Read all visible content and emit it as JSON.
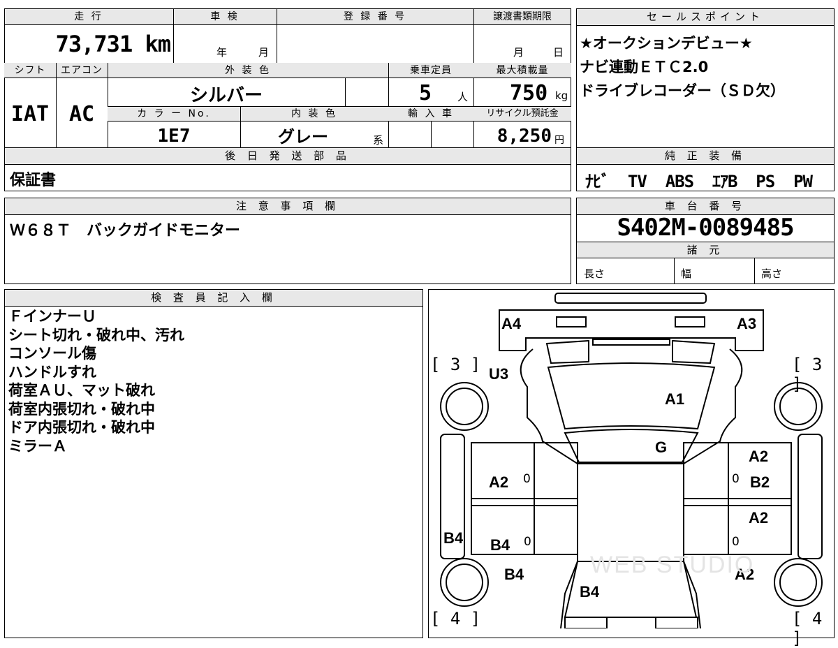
{
  "vehicle": {
    "mileage_label": "走 行",
    "mileage": "73,731 km",
    "inspection_label": "車 検",
    "inspection_year_unit": "年",
    "inspection_month_unit": "月",
    "registration_label": "登 録 番 号",
    "transfer_label": "譲渡書類期限",
    "transfer_month_unit": "月",
    "transfer_day_unit": "日",
    "shift_label": "シフト",
    "shift": "IAT",
    "ac_label": "エアコン",
    "ac": "AC",
    "exterior_color_label": "外 装 色",
    "exterior_color": "シルバー",
    "capacity_label": "乗車定員",
    "capacity": "5",
    "capacity_unit": "人",
    "max_load_label": "最大積載量",
    "max_load": "750",
    "max_load_unit": "kg",
    "color_no_label": "カ ラ ー No.",
    "color_no": "1E7",
    "interior_color_label": "内 装 色",
    "interior_color": "グレー",
    "interior_suffix": "系",
    "import_label": "輸 入 車",
    "recycle_label": "リサイクル預託金",
    "recycle_fee": "8,250",
    "recycle_unit": "円"
  },
  "sales_points": {
    "label": "セールスポイント",
    "lines": [
      "★オークションデビュー★",
      "ナビ連動ＥＴＣ2.0",
      "ドライブレコーダー（ＳＤ欠）"
    ]
  },
  "later_parts": {
    "label": "後 日 発 送 部 品",
    "value": "保証書"
  },
  "genuine_equipment": {
    "label": "純 正 装 備",
    "value": "ﾅﾋﾞ  TV  ABS  ｴｱB  PS  PW"
  },
  "notes": {
    "label": "注 意 事 項 欄",
    "value": "Ｗ６８Ｔ　バックガイドモニター"
  },
  "chassis": {
    "label": "車 台 番 号",
    "value": "S402M-0089485"
  },
  "specs": {
    "label": "諸 元",
    "length_label": "長さ",
    "width_label": "幅",
    "height_label": "高さ"
  },
  "inspector": {
    "label": "検 査 員 記 入 欄",
    "lines": [
      "ＦインナーＵ",
      "シート切れ・破れ中、汚れ",
      "コンソール傷",
      "ハンドルすれ",
      "荷室ＡＵ、マット破れ",
      "荷室内張切れ・破れ中",
      "ドア内張切れ・破れ中",
      "ミラーＡ"
    ]
  },
  "diagram": {
    "marks": {
      "front_left": "A4",
      "front_right": "A3",
      "hood_left": "U3",
      "windshield": "A1",
      "roof": "G",
      "left_front_door": "A2",
      "right_front_door_top": "A2",
      "right_front_door": "B2",
      "right_rear_door_top": "A2",
      "left_rear_door": "B4",
      "left_sill": "B4",
      "left_rear_fender": "B4",
      "rear": "B4",
      "right_rear_fender": "A2"
    },
    "zero": "0",
    "tire_front_left": "[ 3 ]",
    "tire_front_right": "[ 3 ]",
    "tire_rear_left": "[ 4 ]",
    "tire_rear_right": "[ 4 ]",
    "watermark": "WEB STUDIO"
  }
}
